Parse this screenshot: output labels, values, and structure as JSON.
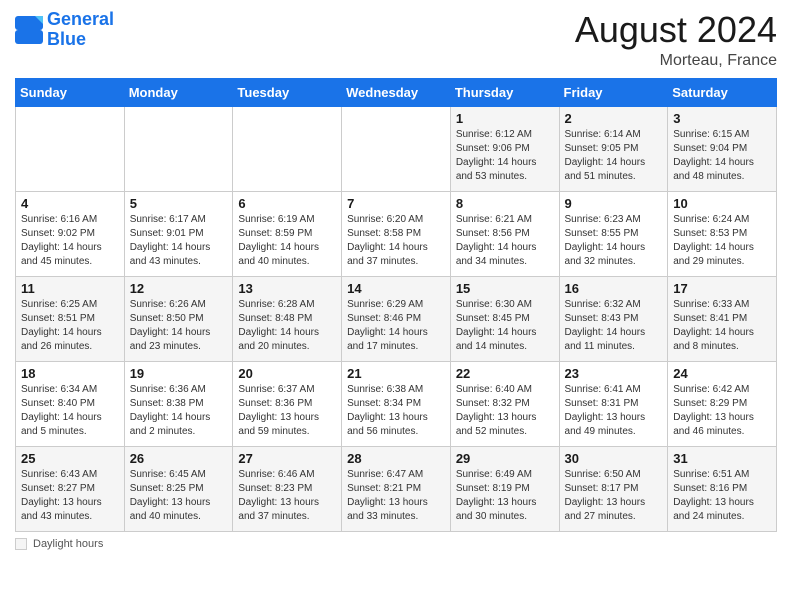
{
  "header": {
    "logo_line1": "General",
    "logo_line2": "Blue",
    "month_year": "August 2024",
    "location": "Morteau, France"
  },
  "footer": {
    "label": "Daylight hours"
  },
  "days_of_week": [
    "Sunday",
    "Monday",
    "Tuesday",
    "Wednesday",
    "Thursday",
    "Friday",
    "Saturday"
  ],
  "weeks": [
    [
      {
        "day": "",
        "info": ""
      },
      {
        "day": "",
        "info": ""
      },
      {
        "day": "",
        "info": ""
      },
      {
        "day": "",
        "info": ""
      },
      {
        "day": "1",
        "info": "Sunrise: 6:12 AM\nSunset: 9:06 PM\nDaylight: 14 hours\nand 53 minutes."
      },
      {
        "day": "2",
        "info": "Sunrise: 6:14 AM\nSunset: 9:05 PM\nDaylight: 14 hours\nand 51 minutes."
      },
      {
        "day": "3",
        "info": "Sunrise: 6:15 AM\nSunset: 9:04 PM\nDaylight: 14 hours\nand 48 minutes."
      }
    ],
    [
      {
        "day": "4",
        "info": "Sunrise: 6:16 AM\nSunset: 9:02 PM\nDaylight: 14 hours\nand 45 minutes."
      },
      {
        "day": "5",
        "info": "Sunrise: 6:17 AM\nSunset: 9:01 PM\nDaylight: 14 hours\nand 43 minutes."
      },
      {
        "day": "6",
        "info": "Sunrise: 6:19 AM\nSunset: 8:59 PM\nDaylight: 14 hours\nand 40 minutes."
      },
      {
        "day": "7",
        "info": "Sunrise: 6:20 AM\nSunset: 8:58 PM\nDaylight: 14 hours\nand 37 minutes."
      },
      {
        "day": "8",
        "info": "Sunrise: 6:21 AM\nSunset: 8:56 PM\nDaylight: 14 hours\nand 34 minutes."
      },
      {
        "day": "9",
        "info": "Sunrise: 6:23 AM\nSunset: 8:55 PM\nDaylight: 14 hours\nand 32 minutes."
      },
      {
        "day": "10",
        "info": "Sunrise: 6:24 AM\nSunset: 8:53 PM\nDaylight: 14 hours\nand 29 minutes."
      }
    ],
    [
      {
        "day": "11",
        "info": "Sunrise: 6:25 AM\nSunset: 8:51 PM\nDaylight: 14 hours\nand 26 minutes."
      },
      {
        "day": "12",
        "info": "Sunrise: 6:26 AM\nSunset: 8:50 PM\nDaylight: 14 hours\nand 23 minutes."
      },
      {
        "day": "13",
        "info": "Sunrise: 6:28 AM\nSunset: 8:48 PM\nDaylight: 14 hours\nand 20 minutes."
      },
      {
        "day": "14",
        "info": "Sunrise: 6:29 AM\nSunset: 8:46 PM\nDaylight: 14 hours\nand 17 minutes."
      },
      {
        "day": "15",
        "info": "Sunrise: 6:30 AM\nSunset: 8:45 PM\nDaylight: 14 hours\nand 14 minutes."
      },
      {
        "day": "16",
        "info": "Sunrise: 6:32 AM\nSunset: 8:43 PM\nDaylight: 14 hours\nand 11 minutes."
      },
      {
        "day": "17",
        "info": "Sunrise: 6:33 AM\nSunset: 8:41 PM\nDaylight: 14 hours\nand 8 minutes."
      }
    ],
    [
      {
        "day": "18",
        "info": "Sunrise: 6:34 AM\nSunset: 8:40 PM\nDaylight: 14 hours\nand 5 minutes."
      },
      {
        "day": "19",
        "info": "Sunrise: 6:36 AM\nSunset: 8:38 PM\nDaylight: 14 hours\nand 2 minutes."
      },
      {
        "day": "20",
        "info": "Sunrise: 6:37 AM\nSunset: 8:36 PM\nDaylight: 13 hours\nand 59 minutes."
      },
      {
        "day": "21",
        "info": "Sunrise: 6:38 AM\nSunset: 8:34 PM\nDaylight: 13 hours\nand 56 minutes."
      },
      {
        "day": "22",
        "info": "Sunrise: 6:40 AM\nSunset: 8:32 PM\nDaylight: 13 hours\nand 52 minutes."
      },
      {
        "day": "23",
        "info": "Sunrise: 6:41 AM\nSunset: 8:31 PM\nDaylight: 13 hours\nand 49 minutes."
      },
      {
        "day": "24",
        "info": "Sunrise: 6:42 AM\nSunset: 8:29 PM\nDaylight: 13 hours\nand 46 minutes."
      }
    ],
    [
      {
        "day": "25",
        "info": "Sunrise: 6:43 AM\nSunset: 8:27 PM\nDaylight: 13 hours\nand 43 minutes."
      },
      {
        "day": "26",
        "info": "Sunrise: 6:45 AM\nSunset: 8:25 PM\nDaylight: 13 hours\nand 40 minutes."
      },
      {
        "day": "27",
        "info": "Sunrise: 6:46 AM\nSunset: 8:23 PM\nDaylight: 13 hours\nand 37 minutes."
      },
      {
        "day": "28",
        "info": "Sunrise: 6:47 AM\nSunset: 8:21 PM\nDaylight: 13 hours\nand 33 minutes."
      },
      {
        "day": "29",
        "info": "Sunrise: 6:49 AM\nSunset: 8:19 PM\nDaylight: 13 hours\nand 30 minutes."
      },
      {
        "day": "30",
        "info": "Sunrise: 6:50 AM\nSunset: 8:17 PM\nDaylight: 13 hours\nand 27 minutes."
      },
      {
        "day": "31",
        "info": "Sunrise: 6:51 AM\nSunset: 8:16 PM\nDaylight: 13 hours\nand 24 minutes."
      }
    ]
  ]
}
